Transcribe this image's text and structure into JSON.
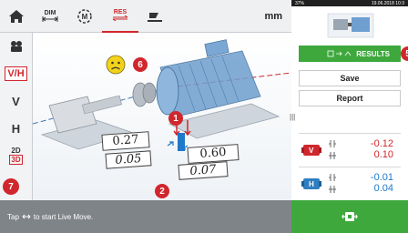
{
  "toolbar": {
    "dim_label": "DIM",
    "res_label": "RES",
    "units": "mm"
  },
  "sidebar": {
    "vh_label": "V/H",
    "v_label": "V",
    "h_label": "H",
    "label_2d": "2D",
    "label_3d": "3D"
  },
  "measurements": {
    "top_left": "0.27",
    "top_right": "0.60",
    "bottom_left": "0.05",
    "bottom_right": "0.07"
  },
  "callouts": {
    "c1": "1",
    "c2": "2",
    "c5": "5",
    "c6": "6",
    "c7": "7"
  },
  "status": {
    "text_before": "Tap",
    "text_after": "to start Live Move."
  },
  "right_panel": {
    "battery": "37%",
    "datetime": "19.06.2018 10:3",
    "results_label": "RESULTS",
    "save_label": "Save",
    "report_label": "Report",
    "v_badge": "V",
    "h_badge": "H",
    "v_values": [
      "-0.12",
      "0.10"
    ],
    "h_values": [
      "-0.01",
      "0.04"
    ]
  },
  "colors": {
    "accent_red": "#d0272d",
    "accent_green": "#3ea83d",
    "value_blue": "#1f78c8"
  }
}
